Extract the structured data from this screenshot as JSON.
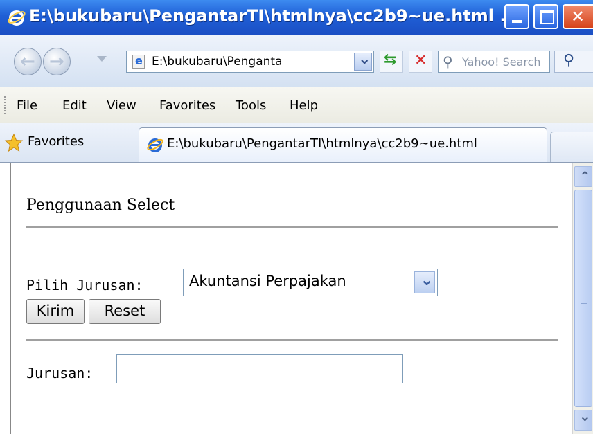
{
  "window": {
    "title": "E:\\bukubaru\\PengantarTI\\htmlnya\\cc2b9~ue.html ..."
  },
  "navigation": {
    "address": "E:\\bukubaru\\Penganta",
    "search_placeholder": "Yahoo! Search"
  },
  "menu": {
    "items": [
      "File",
      "Edit",
      "View",
      "Favorites",
      "Tools",
      "Help"
    ]
  },
  "favorites_bar": {
    "favorites_label": "Favorites",
    "tab_title": "E:\\bukubaru\\PengantarTI\\htmlnya\\cc2b9~ue.html"
  },
  "page": {
    "heading": "Penggunaan Select",
    "select_label": "Pilih Jurusan:",
    "select_value": "Akuntansi Perpajakan",
    "submit_label": "Kirim",
    "reset_label": "Reset",
    "output_label": "Jurusan:",
    "output_value": ""
  },
  "colors": {
    "titlebar": "#1f5fd6",
    "close_button": "#d6431a"
  }
}
